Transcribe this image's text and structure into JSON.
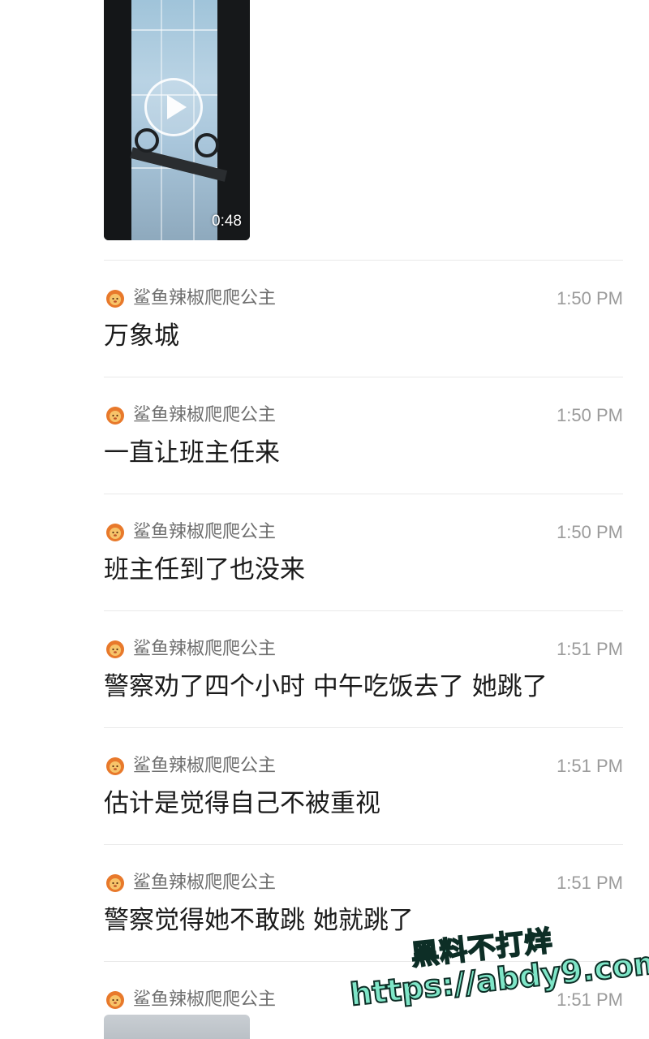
{
  "video": {
    "duration": "0:48",
    "play_icon": "play-icon"
  },
  "messages": [
    {
      "sender": "鲨鱼辣椒爬爬公主",
      "time": "1:50 PM",
      "text": "万象城"
    },
    {
      "sender": "鲨鱼辣椒爬爬公主",
      "time": "1:50 PM",
      "text": "一直让班主任来"
    },
    {
      "sender": "鲨鱼辣椒爬爬公主",
      "time": "1:50 PM",
      "text": "班主任到了也没来"
    },
    {
      "sender": "鲨鱼辣椒爬爬公主",
      "time": "1:51 PM",
      "text": "警察劝了四个小时 中午吃饭去了 她跳了"
    },
    {
      "sender": "鲨鱼辣椒爬爬公主",
      "time": "1:51 PM",
      "text": "估计是觉得自己不被重视"
    },
    {
      "sender": "鲨鱼辣椒爬爬公主",
      "time": "1:51 PM",
      "text": "警察觉得她不敢跳 她就跳了"
    },
    {
      "sender": "鲨鱼辣椒爬爬公主",
      "time": "1:51 PM",
      "text": ""
    }
  ],
  "avatar_icon": "lion-face-icon",
  "watermark": {
    "line1": "黑料不打烊",
    "line2": "https://abdy9.com"
  },
  "colors": {
    "watermark_fill": "#7fe6c8",
    "sender_text": "#6e6e6e",
    "time_text": "#9b9b9b",
    "message_text": "#1b1b1b",
    "divider": "#e9e9e9"
  }
}
